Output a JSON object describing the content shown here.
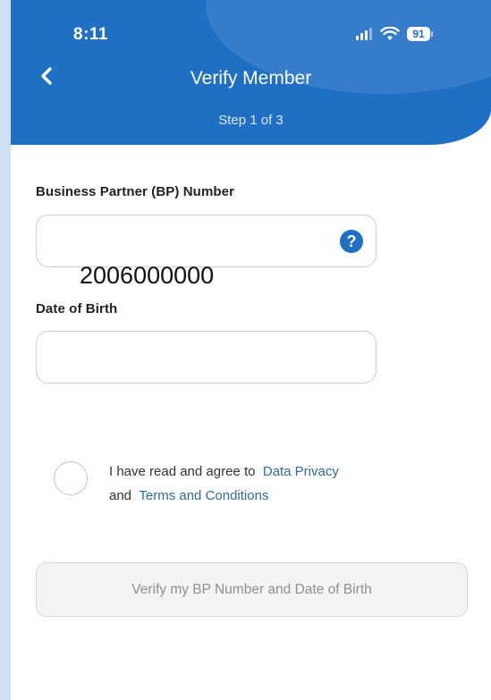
{
  "status_bar": {
    "time": "8:11",
    "battery": "91"
  },
  "header": {
    "back_icon": "chevron-left-icon",
    "title": "Verify Member",
    "step": "Step 1 of 3"
  },
  "form": {
    "bp_label": "Business Partner (BP) Number",
    "bp_value": "",
    "bp_help_icon": "question-circle-icon",
    "bp_overlay_value": "2006000000",
    "dob_label": "Date of Birth",
    "dob_value": ""
  },
  "consent": {
    "text_1": "I have read and agree to",
    "link_privacy": "Data Privacy",
    "text_2": "and",
    "link_terms": "Terms and Conditions"
  },
  "verify_button": {
    "label": "Verify my BP Number and Date of Birth"
  },
  "colors": {
    "primary": "#1f6fc5",
    "link": "#2f6aa8",
    "disabled_bg": "#f4f4f4"
  }
}
